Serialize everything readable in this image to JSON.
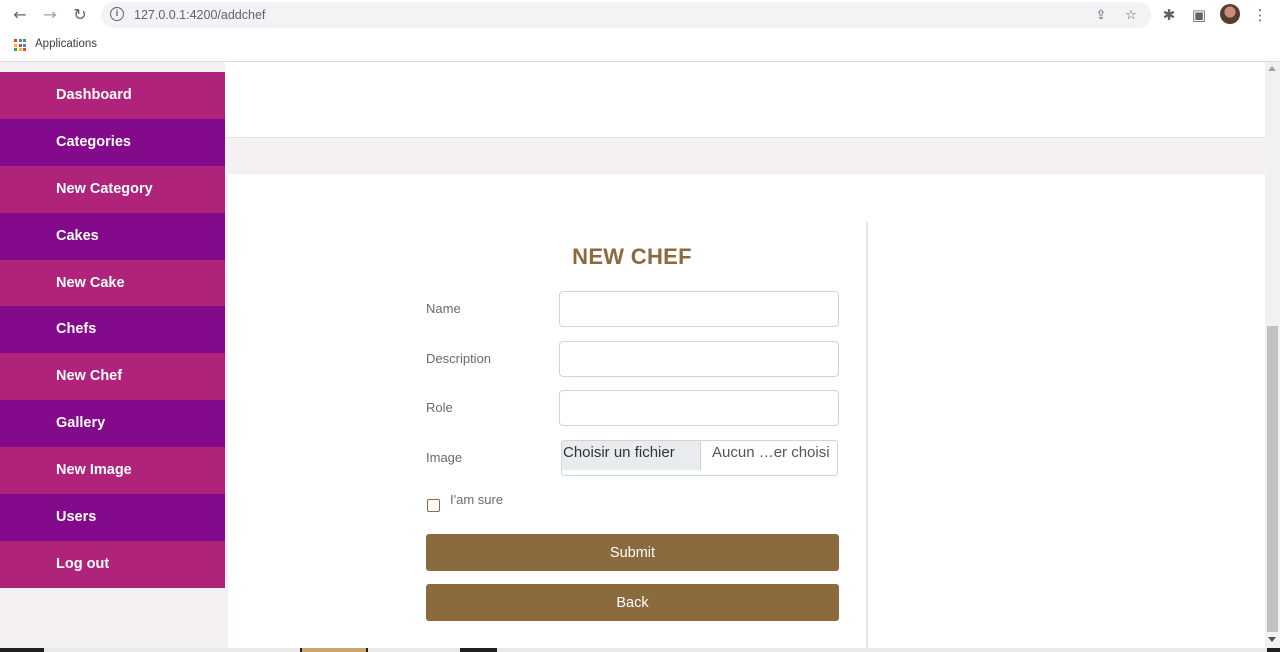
{
  "browser": {
    "url": "127.0.0.1:4200/addchef",
    "bookmark_label": "Applications"
  },
  "icons": {
    "back": "←",
    "forward": "→",
    "reload": "↻",
    "site_info": "i",
    "share": "⇪",
    "bookmark_star": "☆",
    "extensions": "✱",
    "side_panel": "▣",
    "menu": "⋮"
  },
  "sidebar": {
    "items": [
      {
        "label": "Dashboard"
      },
      {
        "label": "Categories"
      },
      {
        "label": "New Category"
      },
      {
        "label": "Cakes"
      },
      {
        "label": "New Cake"
      },
      {
        "label": "Chefs"
      },
      {
        "label": "New Chef"
      },
      {
        "label": "Gallery"
      },
      {
        "label": "New Image"
      },
      {
        "label": "Users"
      },
      {
        "label": "Log out"
      }
    ]
  },
  "form": {
    "title": "NEW CHEF",
    "name_label": "Name",
    "name_value": "",
    "description_label": "Description",
    "description_value": "",
    "role_label": "Role",
    "role_value": "",
    "image_label": "Image",
    "file_button": "Choisir un fichier",
    "file_status": "Aucun …er choisi",
    "checkbox_label": "I'am sure",
    "submit_label": "Submit",
    "back_label": "Back"
  },
  "colors": {
    "sidebar_pink": "#b0237a",
    "sidebar_purple": "#830a8b",
    "accent_brown": "#8b6a3e"
  }
}
